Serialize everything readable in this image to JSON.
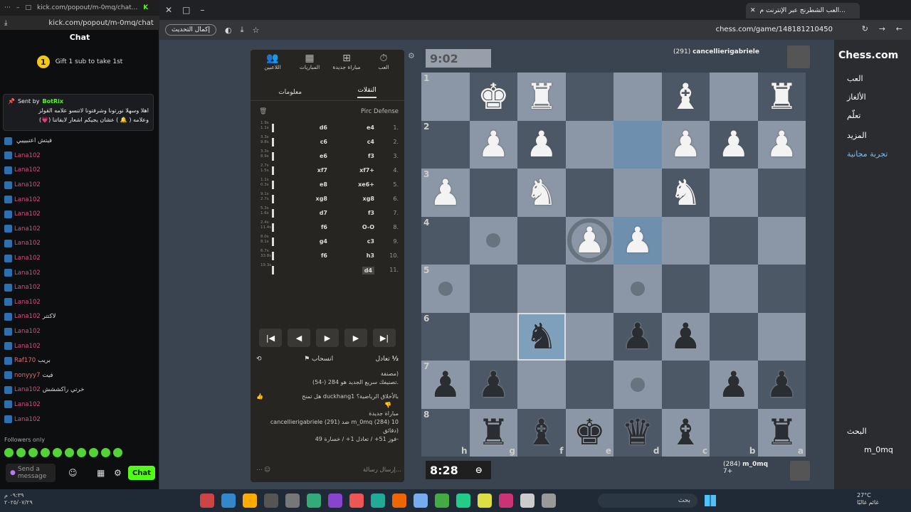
{
  "kick": {
    "url_short": "kick.com/popout/m-0mq/chat...",
    "url": "kick.com/popout/m-0mq/chat",
    "chat_title": "Chat",
    "gift_rank": "1",
    "gift_text": "Gift 1 sub to take 1st",
    "pinned_sender": "Sent by",
    "pinned_user": "BotRix",
    "pinned_line1": "اهلا وسهلا نورتونا وشرفتونا لاتنسو علامه القولز",
    "pinned_line2": "وعلامه ( 🔔 ) عشان يجيكم اشعار لايفاتنا (💗)",
    "messages": [
      {
        "user": "",
        "text": "فيتش اعتبيييي"
      },
      {
        "user": "Lana102",
        "text": ""
      },
      {
        "user": "Lana102",
        "text": ""
      },
      {
        "user": "Lana102",
        "text": ""
      },
      {
        "user": "Lana102",
        "text": ""
      },
      {
        "user": "Lana102",
        "text": ""
      },
      {
        "user": "Lana102",
        "text": ""
      },
      {
        "user": "Lana102",
        "text": ""
      },
      {
        "user": "Lana102",
        "text": ""
      },
      {
        "user": "Lana102",
        "text": ""
      },
      {
        "user": "Lana102",
        "text": ""
      },
      {
        "user": "Lana102",
        "text": ""
      },
      {
        "user": "Lana102",
        "text": "لاكتتر"
      },
      {
        "user": "Lana102",
        "text": ""
      },
      {
        "user": "Lana102",
        "text": ""
      },
      {
        "user": "Raf170",
        "text": "بريب"
      },
      {
        "user": "nonyyy7",
        "text": "فيت"
      },
      {
        "user": "Lana102",
        "text": "خرتي راكششش"
      },
      {
        "user": "Lana102",
        "text": ""
      },
      {
        "user": "Lana102",
        "text": ""
      }
    ],
    "followers_only": "Followers only",
    "send_placeholder": "Send a message",
    "chat_button": "Chat",
    "time": "٠٩:٣٩ م",
    "date": "٢٠٢٥/٠٧/٢٩"
  },
  "browser": {
    "tab_title": "العب الشطرنج عبر الإنترنت م...",
    "update_button": "إكمال التحديث",
    "url": "chess.com/game/148181210450"
  },
  "nav": {
    "logo": "Chess.com",
    "items": [
      "العب",
      "الألغاز",
      "تعلّم",
      "المزيد",
      "تجربة مجانية"
    ],
    "search": "البحث",
    "username": "m_0mq"
  },
  "panel": {
    "tabs": [
      "العب",
      "مباراة جديدة",
      "المباريات",
      "اللاعبين"
    ],
    "subtabs": [
      "النقلات",
      "معلومات"
    ],
    "opening": "Pirc Defense",
    "moves": [
      {
        "n": "1.",
        "w": "e4",
        "b": "d6",
        "tw": "1.9s",
        "tb": "1.1s"
      },
      {
        "n": "2.",
        "w": "c4",
        "b": "c6",
        "tw": "3.3s",
        "tb": "9.8s"
      },
      {
        "n": "3.",
        "w": "f3",
        "b": "e6",
        "tw": "3.3s",
        "tb": "8.9s"
      },
      {
        "n": "4.",
        "w": "xf7+",
        "b": "xf7",
        "tw": "2.7s",
        "tb": "1.5s"
      },
      {
        "n": "5.",
        "w": "xe6+",
        "b": "e8",
        "tw": "1.1s",
        "tb": "0.3s"
      },
      {
        "n": "6.",
        "w": "xg8",
        "b": "xg8",
        "tw": "9.1s",
        "tb": "2.7s"
      },
      {
        "n": "7.",
        "w": "f3",
        "b": "d7",
        "tw": "5.3s",
        "tb": "1.6s"
      },
      {
        "n": "8.",
        "w": "O-O",
        "b": "f6",
        "tw": "2.4s",
        "tb": "11.4s"
      },
      {
        "n": "9.",
        "w": "c3",
        "b": "g4",
        "tw": "8.0s",
        "tb": "8.1s"
      },
      {
        "n": "10.",
        "w": "h3",
        "b": "f6",
        "tw": "6.7s",
        "tb": "33.8s"
      },
      {
        "n": "11.",
        "w": "d4",
        "b": "",
        "tw": "19.3s",
        "tb": ""
      }
    ],
    "draw": "تعادل",
    "resign": "انسحاب",
    "half": "½",
    "chat_lines": [
      "مصنفة)",
      "تصنيفك سريع الجديد هو 284 (-54).",
      "هل تمنح duckhang1 بالأخلاق الرياضية؟",
      "مباراة جديدة",
      "cancellierigabriele (291) ضد m_0mq (284) 10",
      "دقائق)",
      "فوز 51+ / تعادل 1+ / خسارة 49-"
    ],
    "send_placeholder": "إرسال رسالة..."
  },
  "game": {
    "opp_clock": "9:02",
    "opp_name": "cancellierigabriele",
    "opp_rating": "(291)",
    "my_clock": "8:28",
    "my_name": "m_0mq",
    "my_rating": "(284)",
    "material": "7+"
  },
  "taskbar": {
    "search": "بحث",
    "temp": "27°C",
    "weather": "غائم غالبًا"
  }
}
